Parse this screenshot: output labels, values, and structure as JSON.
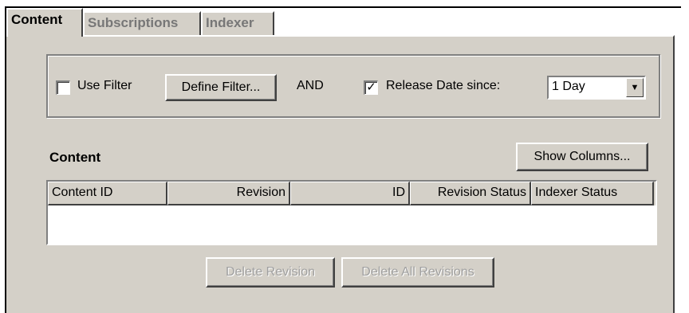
{
  "tabs": [
    {
      "label": "Content",
      "active": true
    },
    {
      "label": "Subscriptions",
      "active": false
    },
    {
      "label": "Indexer",
      "active": false
    }
  ],
  "filter": {
    "use_filter_label": "Use Filter",
    "use_filter_checked": false,
    "define_filter_label": "Define Filter...",
    "and_label": "AND",
    "release_date_label": "Release Date since:",
    "release_date_checked": true,
    "release_date_value": "1 Day"
  },
  "content": {
    "title": "Content",
    "show_columns_label": "Show Columns...",
    "columns": [
      "Content ID",
      "Revision",
      "ID",
      "Revision Status",
      "Indexer Status"
    ],
    "rows": []
  },
  "actions": {
    "delete_revision_label": "Delete Revision",
    "delete_all_revisions_label": "Delete All Revisions"
  },
  "icons": {
    "checkmark": "check-icon",
    "dropdown": "chevron-down-icon"
  }
}
